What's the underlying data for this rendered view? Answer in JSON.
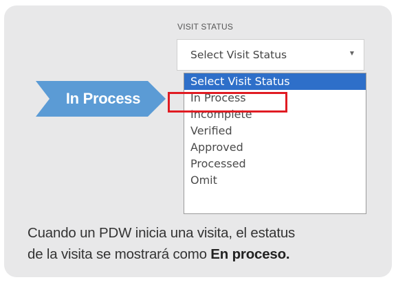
{
  "field": {
    "label": "VISIT STATUS",
    "selected_value": "Select Visit Status",
    "caret": "▼"
  },
  "dropdown": {
    "options": [
      "Select Visit Status",
      "In Process",
      "Incomplete",
      "Verified",
      "Approved",
      "Processed",
      "Omit"
    ],
    "highlighted_option": "Select Visit Status",
    "boxed_option": "In Process"
  },
  "callout": {
    "label": "In Process"
  },
  "caption": {
    "line1": "Cuando un PDW inicia una visita, el estatus",
    "line2_prefix": "de la visita se mostrará como ",
    "line2_bold": "En proceso."
  },
  "colors": {
    "panel_background": "#e8e8e9",
    "callout_blue": "#5b9bd5",
    "selected_option_blue": "#2e6fc9",
    "highlight_red": "#e01b22"
  }
}
